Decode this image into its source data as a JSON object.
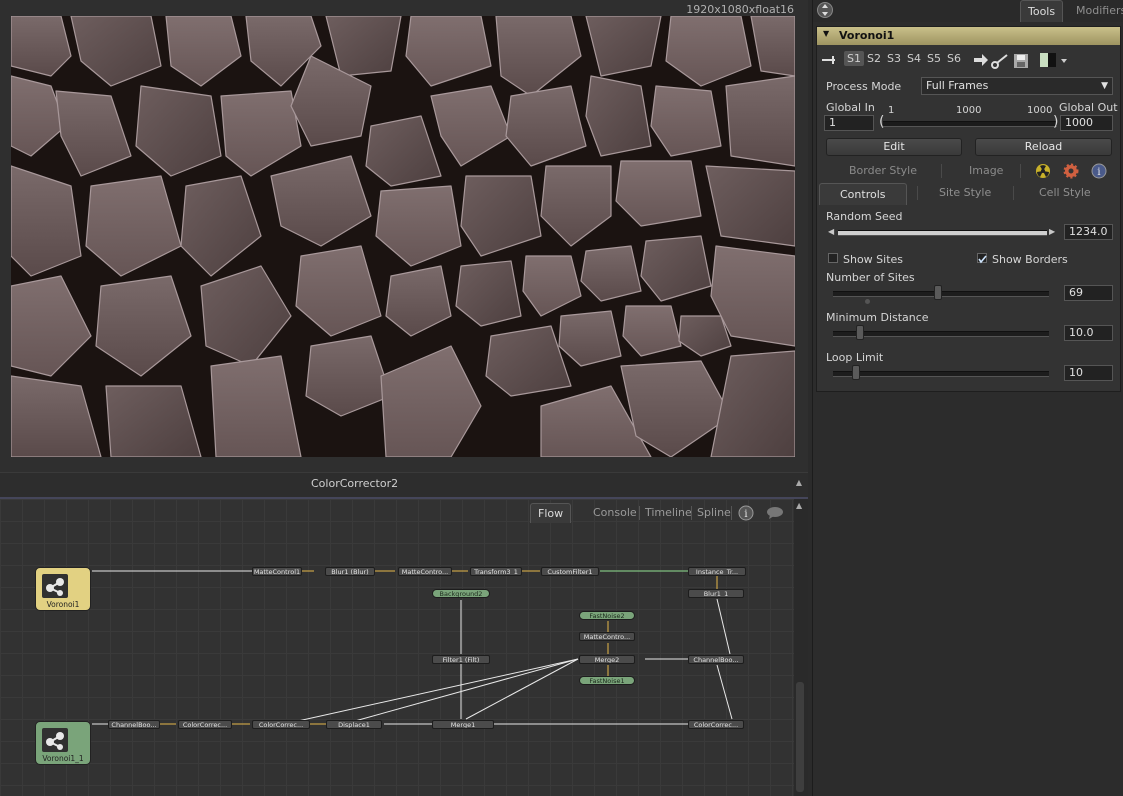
{
  "viewer": {
    "resolution": "1920x1080xfloat16",
    "footer_title": "ColorCorrector2"
  },
  "flow": {
    "tabs": [
      "Flow",
      "Console",
      "Timeline",
      "Spline"
    ],
    "nodes": {
      "voronoi1": "Voronoi1",
      "voronoi1_1": "Voronoi1_1",
      "mattecontrol1": "MatteControl1",
      "blur1": "Blur1 (Blur)",
      "mattecontrol_a": "MatteContro...",
      "transform3_1": "Transform3_1",
      "customfilter1": "CustomFilter1",
      "instance_tr": "Instance_Tr...",
      "background2": "Background2",
      "blur1_1": "Blur1_1",
      "fastnoise2": "FastNoise2",
      "mattecontrol_b": "MatteContro...",
      "filter1": "Filter1 (Filt)",
      "merge2": "Merge2",
      "channelboo_a": "ChannelBoo...",
      "fastnoise1": "FastNoise1",
      "channelboo_b": "ChannelBoo...",
      "colorcorrec_a": "ColorCorrec...",
      "colorcorrec_b": "ColorCorrec...",
      "displace1": "Displace1",
      "merge1": "Merge1",
      "colorcorrec_c": "ColorCorrec..."
    }
  },
  "right_panel": {
    "tabs": [
      "Tools",
      "Modifiers"
    ],
    "tool_name": "Voronoi1",
    "scenes": [
      "S1",
      "S2",
      "S3",
      "S4",
      "S5",
      "S6"
    ],
    "process_mode_label": "Process Mode",
    "process_mode_value": "Full Frames",
    "global_in_label": "Global In",
    "global_out_label": "Global Out",
    "global_in_value": "1",
    "global_out_value": "1000",
    "range_start": "1",
    "range_mid": "1000",
    "range_end": "1000",
    "edit_label": "Edit",
    "reload_label": "Reload",
    "subtabs_top": [
      "Border Style",
      "Image"
    ],
    "subtabs_bottom": [
      "Controls",
      "Site Style",
      "Cell Style"
    ],
    "random_seed_label": "Random Seed",
    "random_seed_value": "1234.0",
    "show_sites_label": "Show Sites",
    "show_sites_checked": false,
    "show_borders_label": "Show Borders",
    "show_borders_checked": true,
    "number_of_sites_label": "Number of Sites",
    "number_of_sites_value": "69",
    "number_of_sites_fraction": 0.48,
    "minimum_distance_label": "Minimum Distance",
    "minimum_distance_value": "10.0",
    "minimum_distance_fraction": 0.12,
    "loop_limit_label": "Loop Limit",
    "loop_limit_value": "10",
    "loop_limit_fraction": 0.1,
    "accent_color": "#c9c08a"
  }
}
